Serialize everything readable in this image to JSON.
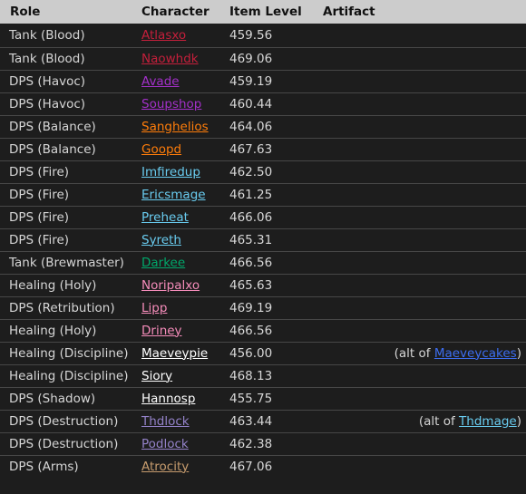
{
  "headers": {
    "role": "Role",
    "character": "Character",
    "item_level": "Item Level",
    "artifact": "Artifact"
  },
  "alt_prefix": "(alt of ",
  "alt_suffix": ")",
  "class_colors": {
    "death_knight": "#c41f3b",
    "demon_hunter": "#a330c9",
    "druid": "#ff7d0a",
    "mage": "#69ccf0",
    "monk": "#00a86b",
    "paladin": "#f58cba",
    "priest": "#ffffff",
    "warlock": "#9482c9",
    "warrior": "#c79c6e",
    "alt_link": "#3c6df0"
  },
  "rows": [
    {
      "role": "Tank (Blood)",
      "character": "Atlasxo",
      "class": "death_knight",
      "item_level": "459.56",
      "artifact": ""
    },
    {
      "role": "Tank (Blood)",
      "character": "Naowhdk",
      "class": "death_knight",
      "item_level": "469.06",
      "artifact": ""
    },
    {
      "role": "DPS (Havoc)",
      "character": "Avade",
      "class": "demon_hunter",
      "item_level": "459.19",
      "artifact": ""
    },
    {
      "role": "DPS (Havoc)",
      "character": "Soupshop",
      "class": "demon_hunter",
      "item_level": "460.44",
      "artifact": ""
    },
    {
      "role": "DPS (Balance)",
      "character": "Sanghelios",
      "class": "druid",
      "item_level": "464.06",
      "artifact": ""
    },
    {
      "role": "DPS (Balance)",
      "character": "Goopd",
      "class": "druid",
      "item_level": "467.63",
      "artifact": ""
    },
    {
      "role": "DPS (Fire)",
      "character": "Imfiredup",
      "class": "mage",
      "item_level": "462.50",
      "artifact": ""
    },
    {
      "role": "DPS (Fire)",
      "character": "Ericsmage",
      "class": "mage",
      "item_level": "461.25",
      "artifact": ""
    },
    {
      "role": "DPS (Fire)",
      "character": "Preheat",
      "class": "mage",
      "item_level": "466.06",
      "artifact": ""
    },
    {
      "role": "DPS (Fire)",
      "character": "Syreth",
      "class": "mage",
      "item_level": "465.31",
      "artifact": ""
    },
    {
      "role": "Tank (Brewmaster)",
      "character": "Darkee",
      "class": "monk",
      "item_level": "466.56",
      "artifact": ""
    },
    {
      "role": "Healing (Holy)",
      "character": "Noripalxo",
      "class": "paladin",
      "item_level": "465.63",
      "artifact": ""
    },
    {
      "role": "DPS (Retribution)",
      "character": "Lipp",
      "class": "paladin",
      "item_level": "469.19",
      "artifact": ""
    },
    {
      "role": "Healing (Holy)",
      "character": "Driney",
      "class": "paladin",
      "item_level": "466.56",
      "artifact": ""
    },
    {
      "role": "Healing (Discipline)",
      "character": "Maeveypie",
      "class": "priest",
      "item_level": "456.00",
      "artifact": "",
      "alt_of": "Maeveycakes",
      "alt_class": "alt_link"
    },
    {
      "role": "Healing (Discipline)",
      "character": "Siory",
      "class": "priest",
      "item_level": "468.13",
      "artifact": ""
    },
    {
      "role": "DPS (Shadow)",
      "character": "Hannosp",
      "class": "priest",
      "item_level": "455.75",
      "artifact": ""
    },
    {
      "role": "DPS (Destruction)",
      "character": "Thdlock",
      "class": "warlock",
      "item_level": "463.44",
      "artifact": "",
      "alt_of": "Thdmage",
      "alt_class": "mage"
    },
    {
      "role": "DPS (Destruction)",
      "character": "Podlock",
      "class": "warlock",
      "item_level": "462.38",
      "artifact": ""
    },
    {
      "role": "DPS (Arms)",
      "character": "Atrocity",
      "class": "warrior",
      "item_level": "467.06",
      "artifact": ""
    }
  ]
}
